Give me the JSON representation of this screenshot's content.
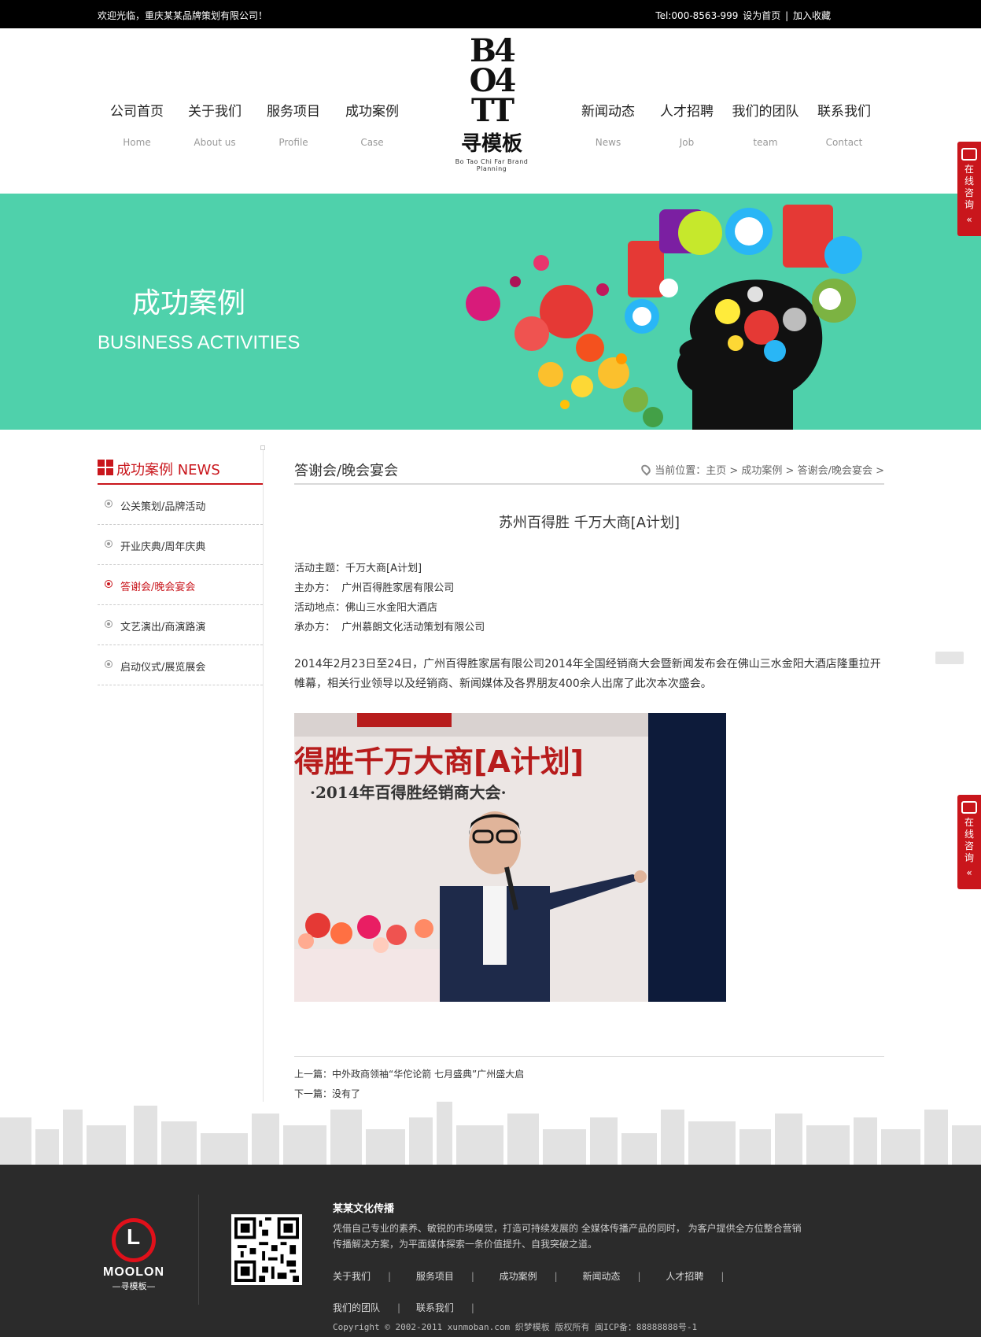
{
  "topbar": {
    "welcome": "欢迎光临，重庆某某品牌策划有限公司！",
    "tel": "Tel:000-8563-999",
    "set_home": "设为首页",
    "separator": "|",
    "favorite": "加入收藏"
  },
  "nav": {
    "left": [
      {
        "cn": "公司首页",
        "en": "Home"
      },
      {
        "cn": "关于我们",
        "en": "About us"
      },
      {
        "cn": "服务项目",
        "en": "Profile"
      },
      {
        "cn": "成功案例",
        "en": "Case"
      }
    ],
    "right": [
      {
        "cn": "新闻动态",
        "en": "News"
      },
      {
        "cn": "人才招聘",
        "en": "Job"
      },
      {
        "cn": "我们的团队",
        "en": "team"
      },
      {
        "cn": "联系我们",
        "en": "Contact"
      }
    ]
  },
  "logo": {
    "mark_line1": "B4",
    "mark_line2": "O4",
    "mark_line3": "TT",
    "brand": "寻模板",
    "slogan": "Bo Tao Chi Far Brand Planning"
  },
  "banner": {
    "title_cn": "成功案例",
    "title_en": "BUSINESS ACTIVITIES",
    "bg_color": "#4fd1ab"
  },
  "float_tab": {
    "chars": [
      "在",
      "线",
      "咨",
      "询"
    ],
    "arrow": "«"
  },
  "sidebar": {
    "title": "成功案例 NEWS",
    "items": [
      {
        "label": "公关策划/品牌活动",
        "active": false
      },
      {
        "label": "开业庆典/周年庆典",
        "active": false
      },
      {
        "label": "答谢会/晚会宴会",
        "active": true
      },
      {
        "label": "文艺演出/商演路演",
        "active": false
      },
      {
        "label": "启动仪式/展览展会",
        "active": false
      }
    ]
  },
  "main": {
    "sub_title": "答谢会/晚会宴会",
    "breadcrumb": "当前位置：主页 > 成功案例 > 答谢会/晚会宴会 >",
    "article_title": "苏州百得胜 千万大商[A计划]",
    "info": [
      "活动主题：千万大商[A计划]",
      "主办方：  广州百得胜家居有限公司",
      "活动地点：佛山三水金阳大酒店",
      "承办方：  广州慕朗文化活动策划有限公司"
    ],
    "paragraph": "2014年2月23日至24日，广州百得胜家居有限公司2014年全国经销商大会暨新闻发布会在佛山三水金阳大酒店隆重拉开帷幕，相关行业领导以及经销商、新闻媒体及各界朋友400余人出席了此次本次盛会。",
    "photo_text_line1": "得胜千万大商[A计划]",
    "photo_text_line2": "·2014年百得胜经销商大会·",
    "prev_label": "上一篇：",
    "prev_text": "中外政商领袖“华佗论箭 七月盛典”广州盛大启",
    "next_label": "下一篇：",
    "next_text": "没有了"
  },
  "footer": {
    "logo_name": "MOOLON",
    "logo_sub": "—寻模板—",
    "company": "某某文化传播",
    "desc": "凭借自己专业的素养、敏锐的市场嗅觉，打造可持续发展的 全媒体传播产品的同时， 为客户提供全方位整合营销传播解决方案，为平面媒体探索一条价值提升、自我突破之道。",
    "links": [
      "关于我们",
      "服务项目",
      "成功案例",
      "新闻动态",
      "人才招聘",
      "我们的团队",
      "联系我们"
    ],
    "copyright": "Copyright © 2002-2011 xunmoban.com 织梦模板 版权所有 闽ICP备：88888888号-1"
  },
  "colors": {
    "accent": "#c9161c",
    "footer_bg": "#2b2b2b"
  }
}
